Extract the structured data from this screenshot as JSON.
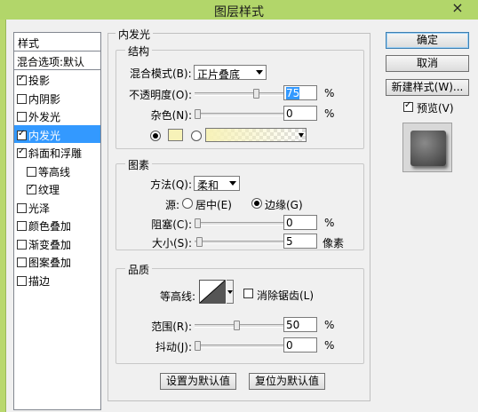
{
  "window": {
    "title": "图层样式",
    "close_symbol": "×"
  },
  "style_list": {
    "header": "样式",
    "blend_options": "混合选项:默认",
    "items": [
      {
        "label": "投影",
        "checked": true
      },
      {
        "label": "内阴影",
        "checked": false
      },
      {
        "label": "外发光",
        "checked": false
      },
      {
        "label": "内发光",
        "checked": true,
        "active": true
      },
      {
        "label": "斜面和浮雕",
        "checked": true
      },
      {
        "label": "等高线",
        "checked": false,
        "sub": true
      },
      {
        "label": "纹理",
        "checked": true,
        "sub": true
      },
      {
        "label": "光泽",
        "checked": false
      },
      {
        "label": "颜色叠加",
        "checked": false
      },
      {
        "label": "渐变叠加",
        "checked": false
      },
      {
        "label": "图案叠加",
        "checked": false
      },
      {
        "label": "描边",
        "checked": false
      }
    ]
  },
  "inner_glow": {
    "title": "内发光",
    "structure": {
      "title": "结构",
      "blend_mode_label": "混合模式(B):",
      "blend_mode_value": "正片叠底",
      "opacity_label": "不透明度(O):",
      "opacity_value": "75",
      "noise_label": "杂色(N):",
      "noise_value": "0",
      "percent": "%",
      "glow_color": "#f7f2b8"
    },
    "elements": {
      "title": "图素",
      "method_label": "方法(Q):",
      "method_value": "柔和",
      "source_label": "源:",
      "source_center": "居中(E)",
      "source_edge": "边缘(G)",
      "choke_label": "阻塞(C):",
      "choke_value": "0",
      "size_label": "大小(S):",
      "size_value": "5",
      "size_unit": "像素",
      "percent": "%"
    },
    "quality": {
      "title": "品质",
      "contour_label": "等高线:",
      "antialias_label": "消除锯齿(L)",
      "range_label": "范围(R):",
      "range_value": "50",
      "jitter_label": "抖动(J):",
      "jitter_value": "0",
      "percent": "%"
    },
    "make_default": "设置为默认值",
    "reset_default": "复位为默认值"
  },
  "buttons": {
    "ok": "确定",
    "cancel": "取消",
    "new_style": "新建样式(W)...",
    "preview_label": "预览(V)"
  }
}
